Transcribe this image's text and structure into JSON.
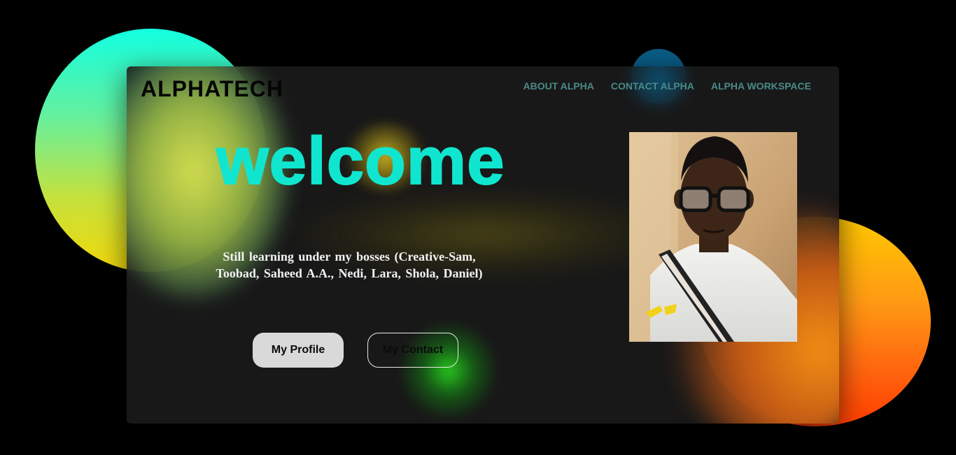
{
  "brand": {
    "logo_text": "ALPHATECH"
  },
  "nav": {
    "items": [
      {
        "label": "ABOUT ALPHA"
      },
      {
        "label": "CONTACT ALPHA"
      },
      {
        "label": "ALPHA WORKSPACE"
      }
    ]
  },
  "hero": {
    "heading": "welcome",
    "tagline": "Still learning under my bosses (Creative-Sam, Toobad, Saheed A.A., Nedi, Lara, Shola, Daniel)",
    "buttons": {
      "profile_label": "My Profile",
      "contact_label": "My Contact"
    }
  },
  "colors": {
    "background": "#000000",
    "card": "#1a1a1a",
    "accent_teal": "#10e6cf",
    "nav_text": "#4a8a88",
    "circle_left_top": "#12ffe1",
    "circle_left_bottom": "#f2d80a",
    "circle_right_top": "#ffc800",
    "circle_right_bottom": "#ff3d00",
    "circle_top": "#0a5c86"
  },
  "icons": {
    "profile_photo": "portrait-photo"
  }
}
